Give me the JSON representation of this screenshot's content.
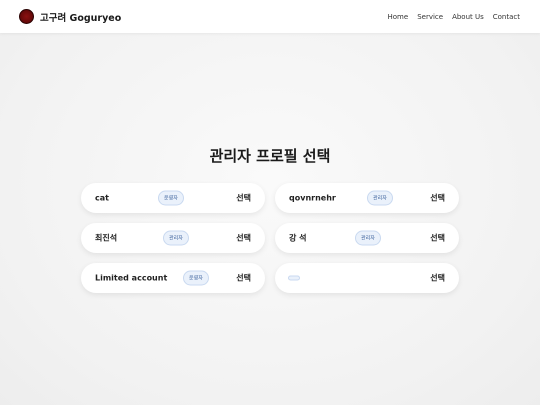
{
  "brand": {
    "logo_icon": "red-circle-logo-icon",
    "name": "고구려 Goguryeo",
    "logo_color": "#7a0c0c"
  },
  "nav": {
    "items": [
      "Home",
      "Service",
      "About Us",
      "Contact"
    ]
  },
  "main": {
    "title": "관리자 프로필 선택"
  },
  "profiles": [
    {
      "name": "cat",
      "role": "운영자",
      "select_label": "선택"
    },
    {
      "name": "qovnrnehr",
      "role": "관리자",
      "select_label": "선택"
    },
    {
      "name": "최진석",
      "role": "관리자",
      "select_label": "선택"
    },
    {
      "name": "강 석",
      "role": "관리자",
      "select_label": "선택"
    },
    {
      "name": "Limited account",
      "role": "운영자",
      "select_label": "선택"
    },
    {
      "name": "",
      "role": "",
      "select_label": "선택"
    }
  ],
  "colors": {
    "badge_bg": "#eaf1fb",
    "badge_text": "#3a5f9a",
    "card_bg": "#ffffff"
  }
}
